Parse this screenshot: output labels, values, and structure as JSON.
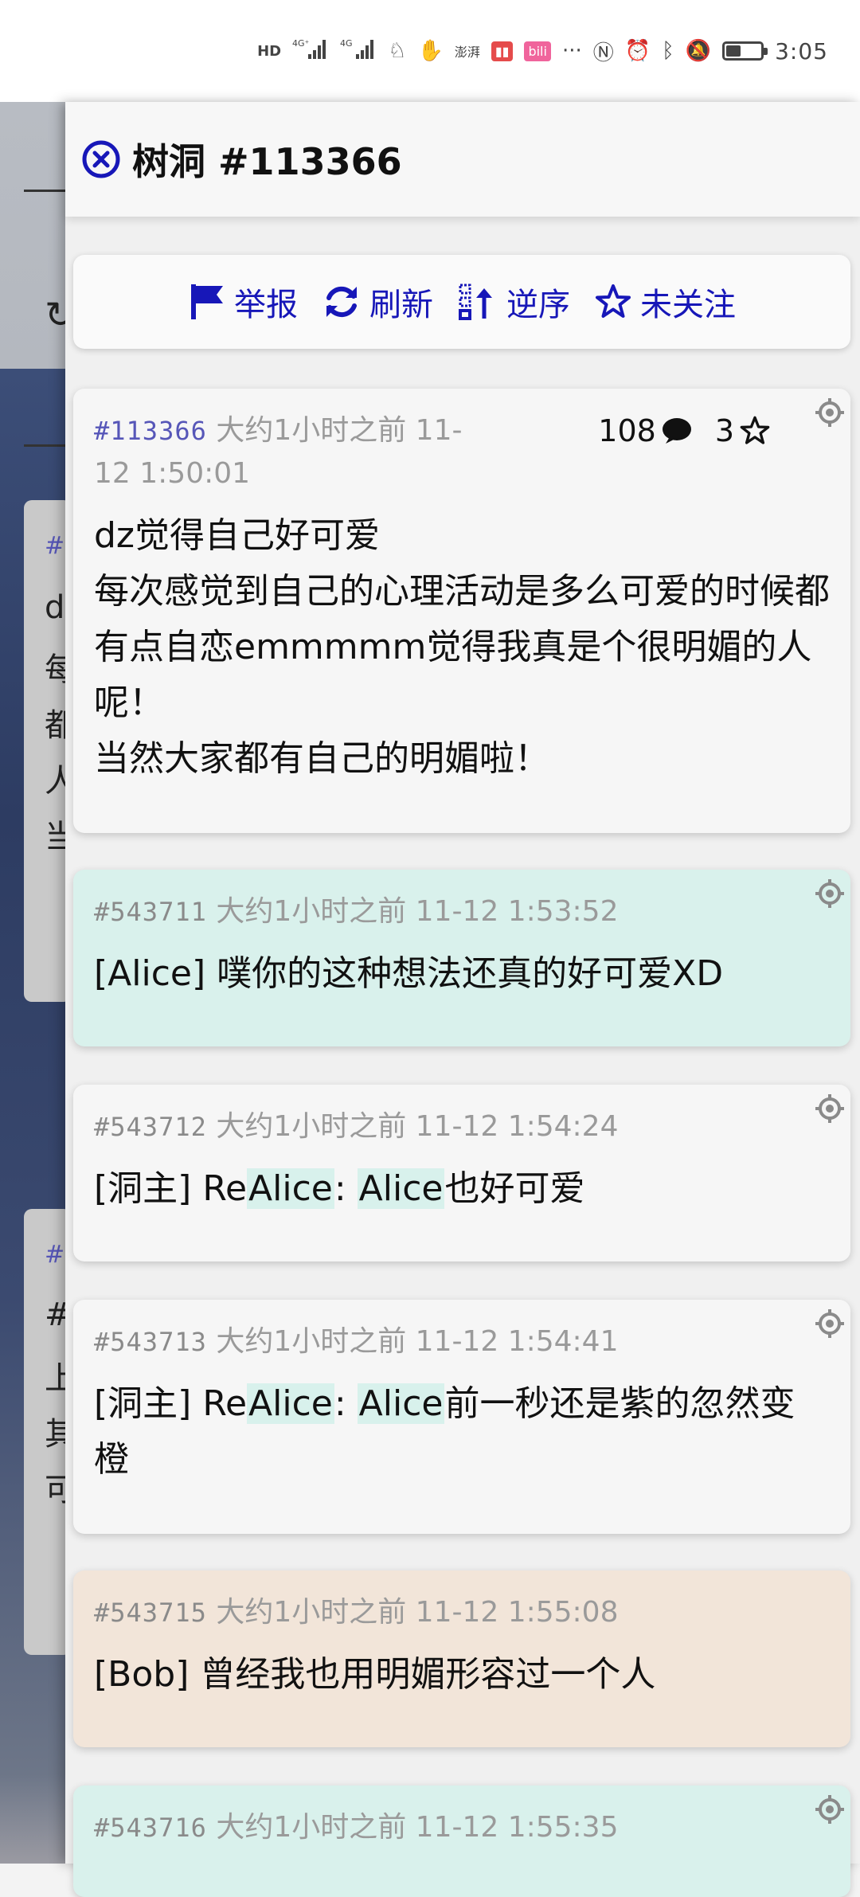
{
  "status_bar": {
    "net1": "HD",
    "net2": "4G",
    "time": "3:05"
  },
  "thread": {
    "title": "树洞 #113366"
  },
  "toolbar": {
    "report": "举报",
    "refresh": "刷新",
    "reverse": "逆序",
    "follow": "未关注"
  },
  "main_post": {
    "id": "#113366",
    "time": "大约1小时之前 11-12 1:50:01",
    "reply_count": "108",
    "star_count": "3",
    "lines": [
      "dz觉得自己好可爱",
      "每次感觉到自己的心理活动是多么可爱的时候都有点自恋emmmmm觉得我真是个很明媚的人呢！",
      "当然大家都有自己的明媚啦！"
    ]
  },
  "replies": [
    {
      "id": "#543711",
      "time": "大约1小时之前 11-12 1:53:52",
      "author": "[Alice]",
      "text": "噗你的这种想法还真的好可爱XD"
    },
    {
      "id": "#543712",
      "time": "大约1小时之前 11-12 1:54:24",
      "author": "[洞主]",
      "re": "Re",
      "mention1": "Alice",
      "colon": ":",
      "mention2": "Alice",
      "text": "也好可爱"
    },
    {
      "id": "#543713",
      "time": "大约1小时之前 11-12 1:54:41",
      "author": "[洞主]",
      "re": "Re",
      "mention1": "Alice",
      "colon": ":",
      "mention2": "Alice",
      "text": "前一秒还是紫的忽然变橙"
    },
    {
      "id": "#543715",
      "time": "大约1小时之前 11-12 1:55:08",
      "author": "[Bob]",
      "text": "曾经我也用明媚形容过一个人"
    },
    {
      "id": "#543716",
      "time": "大约1小时之前 11-12 1:55:35"
    }
  ],
  "bg_page": {
    "c1": "#",
    "c2": "d",
    "c3": "每",
    "c4": "都",
    "c5": "人",
    "c6": "当",
    "c7": "#",
    "c8": "#",
    "c9": "上",
    "c10": "其",
    "c11": "可"
  },
  "colors": {
    "accent": "#1717b8",
    "mint": "#d9f1ec",
    "peach": "#f2e5d9"
  }
}
